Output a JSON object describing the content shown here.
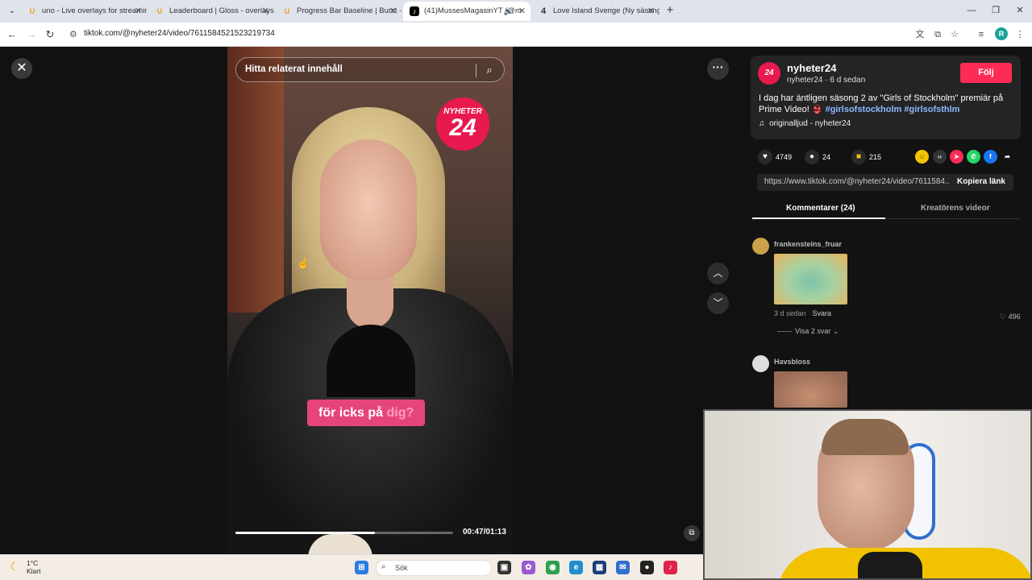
{
  "browser": {
    "tabs": [
      {
        "label": "uno - Live overlays for streamin",
        "icon": "u-logo-icon"
      },
      {
        "label": "Leaderboard | Gloss - overlays.u",
        "icon": "u-logo-icon"
      },
      {
        "label": "Progress Bar Baseline | Burst - ",
        "icon": "u-logo-icon"
      },
      {
        "label": "(41)MussesMagasinYT (@m",
        "icon": "tiktok-icon",
        "active": true
      },
      {
        "label": "Love Island Sverige (Ny säsong",
        "icon": "li-icon"
      }
    ],
    "url": "tiktok.com/@nyheter24/video/7611584521523219734"
  },
  "player": {
    "search_placeholder": "Hitta relaterat innehåll",
    "logo_top": "NYHETER",
    "logo_num": "24",
    "caption_main": "för icks på ",
    "caption_highlight": "dig?",
    "timecode": "00:47/01:13",
    "progress": 0.64
  },
  "post": {
    "avatar_text": "24",
    "author": "nyheter24",
    "subline": "nyheter24 · 6 d sedan",
    "follow_label": "Följ",
    "description": "I dag har äntligen säsong 2 av \"Girls of Stockholm\" premiär på Prime Video! 👙",
    "hashtags": "#girlsofstockholm #girlsofsthlm",
    "music": "originalljud - nyheter24",
    "likes": "4749",
    "comments_count": "24",
    "saves": "215",
    "link": "https://www.tiktok.com/@nyheter24/video/7611584...",
    "copy_label": "Kopiera länk",
    "tab_comments": "Kommentarer (24)",
    "tab_creator": "Kreatörens videor"
  },
  "comments": [
    {
      "user": "frankensteins_fruar",
      "time": "3 d sedan",
      "reply": "Svara",
      "likes": "496",
      "replies": "Visa 2 svar"
    },
    {
      "user": "Havsbloss"
    }
  ],
  "taskbar": {
    "temp": "1°C",
    "weather": "Klart",
    "search": "Sök"
  },
  "colors": {
    "tiktok_red": "#fe2c55",
    "nyheter_pink": "#e8194e",
    "caption_bg": "#e6457b"
  }
}
